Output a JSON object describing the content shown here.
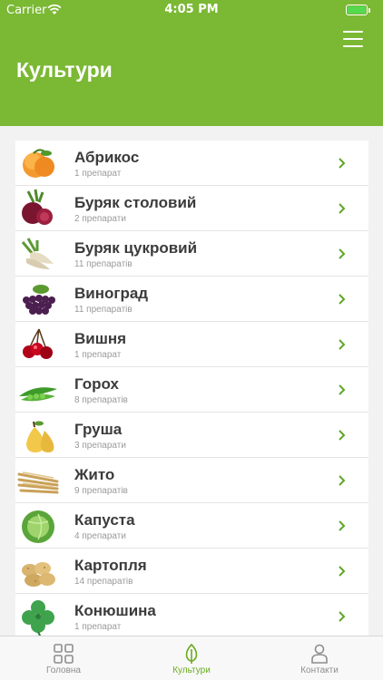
{
  "status_bar": {
    "carrier": "Carrier",
    "time": "4:05 PM"
  },
  "header": {
    "title": "Культури",
    "menu_icon": "hamburger-menu-icon"
  },
  "colors": {
    "header_bg": "#7bb834",
    "accent": "#6aab1f",
    "chevron": "#5fa628"
  },
  "crops": [
    {
      "name": "Абрикос",
      "count": "1 препарат",
      "icon": "apricot"
    },
    {
      "name": "Буряк столовий",
      "count": "2 препарати",
      "icon": "beetroot"
    },
    {
      "name": "Буряк цукровий",
      "count": "11 препаратів",
      "icon": "sugar-beet"
    },
    {
      "name": "Виноград",
      "count": "11 препаратів",
      "icon": "grapes"
    },
    {
      "name": "Вишня",
      "count": "1 препарат",
      "icon": "cherry"
    },
    {
      "name": "Горох",
      "count": "8 препаратів",
      "icon": "peas"
    },
    {
      "name": "Груша",
      "count": "3 препарати",
      "icon": "pear"
    },
    {
      "name": "Жито",
      "count": "9 препаратів",
      "icon": "rye"
    },
    {
      "name": "Капуста",
      "count": "4 препарати",
      "icon": "cabbage"
    },
    {
      "name": "Картопля",
      "count": "14 препаратів",
      "icon": "potato"
    },
    {
      "name": "Конюшина",
      "count": "1 препарат",
      "icon": "clover"
    }
  ],
  "tabbar": {
    "tabs": [
      {
        "label": "Головна",
        "icon": "grid-icon",
        "active": false
      },
      {
        "label": "Культури",
        "icon": "leaf-icon",
        "active": true
      },
      {
        "label": "Контакти",
        "icon": "person-icon",
        "active": false
      }
    ]
  }
}
